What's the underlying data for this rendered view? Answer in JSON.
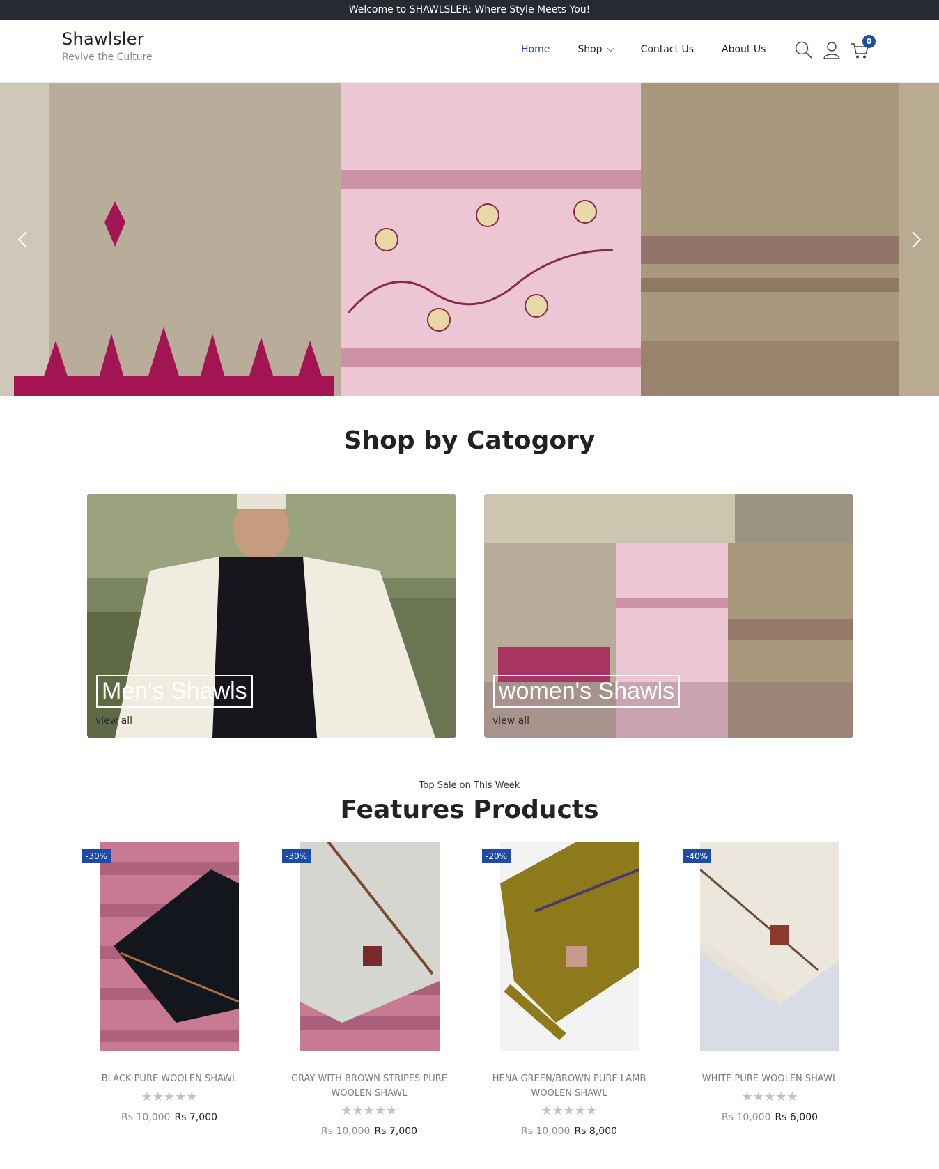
{
  "announcement": "Welcome to SHAWLSLER: Where Style Meets You!",
  "brand": {
    "name": "Shawlsler",
    "tagline": "Revive the Culture"
  },
  "nav": {
    "items": [
      {
        "label": "Home",
        "active": true
      },
      {
        "label": "Shop",
        "has_dropdown": true
      },
      {
        "label": "Contact Us"
      },
      {
        "label": "About Us"
      }
    ]
  },
  "header_icons": {
    "search": "search-icon",
    "account": "user-icon",
    "cart": "cart-icon",
    "cart_count": "0"
  },
  "hero": {
    "prev": "chevron-left-icon",
    "next": "chevron-right-icon"
  },
  "categories": {
    "title": "Shop by Catogory",
    "items": [
      {
        "label": "Men's Shawls",
        "link": "view all"
      },
      {
        "label": "women's Shawls",
        "link": "view all"
      }
    ]
  },
  "featured": {
    "subtitle": "Top Sale on This Week",
    "title": "Features Products",
    "products": [
      {
        "discount": "-30%",
        "name": "BLACK PURE WOOLEN SHAWL",
        "old_price": "Rs 10,000",
        "price": "Rs 7,000",
        "color": "#14161d"
      },
      {
        "discount": "-30%",
        "name": "GRAY WITH BROWN STRIPES PURE WOOLEN SHAWL",
        "old_price": "Rs 10,000",
        "price": "Rs 7,000",
        "color": "#d6d6d0"
      },
      {
        "discount": "-20%",
        "name": "HENA GREEN/BROWN PURE LAMB WOOLEN SHAWL",
        "old_price": "Rs 10,000",
        "price": "Rs 8,000",
        "color": "#8e7a1a"
      },
      {
        "discount": "-40%",
        "name": "WHITE PURE WOOLEN SHAWL",
        "old_price": "Rs 10,000",
        "price": "Rs 6,000",
        "color": "#ece7dd"
      }
    ]
  },
  "colors": {
    "accent": "#1e4aa8",
    "topbar": "#262b33",
    "nav_active": "#1e3f8f"
  }
}
